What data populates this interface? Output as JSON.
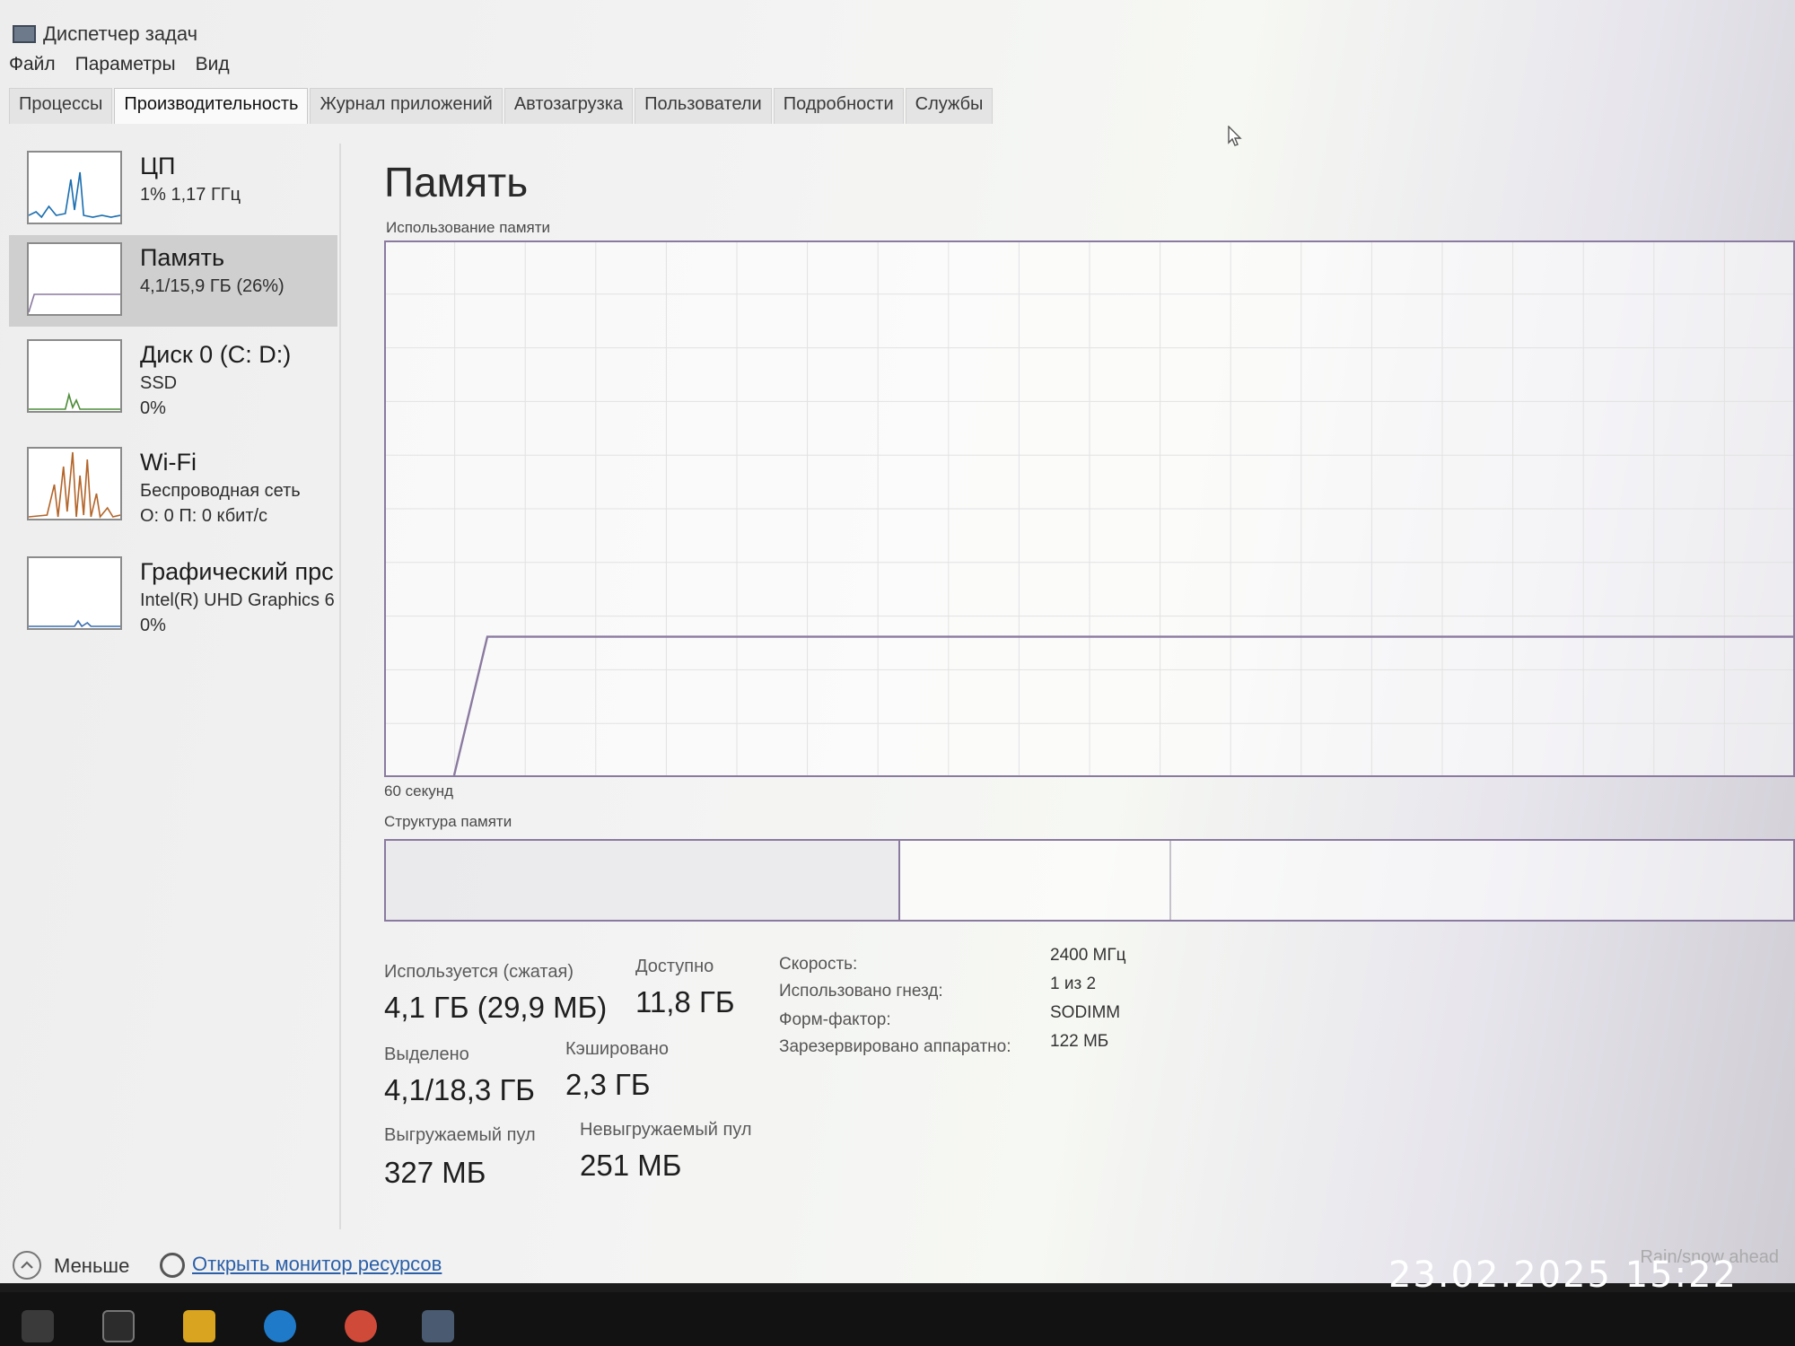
{
  "window": {
    "title": "Диспетчер задач"
  },
  "menu": [
    "Файл",
    "Параметры",
    "Вид"
  ],
  "tabs": [
    "Процессы",
    "Производительность",
    "Журнал приложений",
    "Автозагрузка",
    "Пользователи",
    "Подробности",
    "Службы"
  ],
  "active_tab": "Производительность",
  "sidebar": [
    {
      "title": "ЦП",
      "sub1": "1% 1,17 ГГц",
      "sub2": ""
    },
    {
      "title": "Память",
      "sub1": "4,1/15,9 ГБ (26%)",
      "sub2": ""
    },
    {
      "title": "Диск 0 (C: D:)",
      "sub1": "SSD",
      "sub2": "0%"
    },
    {
      "title": "Wi-Fi",
      "sub1": "Беспроводная сеть",
      "sub2": "О: 0 П: 0 кбит/с"
    },
    {
      "title": "Графический прс",
      "sub1": "Intel(R) UHD Graphics 6",
      "sub2": "0%"
    }
  ],
  "main": {
    "title": "Память",
    "usage_caption": "Использование памяти",
    "time_caption": "60 секунд",
    "structure_caption": "Структура памяти",
    "stats": {
      "in_use_label": "Используется (сжатая)",
      "in_use_value": "4,1 ГБ (29,9 МБ)",
      "available_label": "Доступно",
      "available_value": "11,8 ГБ",
      "committed_label": "Выделено",
      "committed_value": "4,1/18,3 ГБ",
      "cached_label": "Кэшировано",
      "cached_value": "2,3 ГБ",
      "paged_label": "Выгружаемый пул",
      "paged_value": "327 МБ",
      "nonpaged_label": "Невыгружаемый пул",
      "nonpaged_value": "251 МБ"
    },
    "properties": [
      {
        "label": "Скорость:",
        "value": "2400 МГц"
      },
      {
        "label": "Использовано гнезд:",
        "value": "1 из 2"
      },
      {
        "label": "Форм-фактор:",
        "value": "SODIMM"
      },
      {
        "label": "Зарезервировано аппаратно:",
        "value": "122 МБ"
      }
    ],
    "usage_percent": 26
  },
  "footer": {
    "fewer_label": "Меньше",
    "monitor_link": "Открыть монитор ресурсов",
    "weather": "Rain/snow ahead"
  },
  "stamp": "23.02.2025  15:22",
  "colors": {
    "memory_line": "#8b7aa0",
    "grid": "#e2e2e2",
    "selected": "#cfcfcf"
  },
  "icons": {
    "cursor": "cursor-arrow-icon",
    "fewer": "chevron-up-icon",
    "monitor": "resource-monitor-icon"
  }
}
